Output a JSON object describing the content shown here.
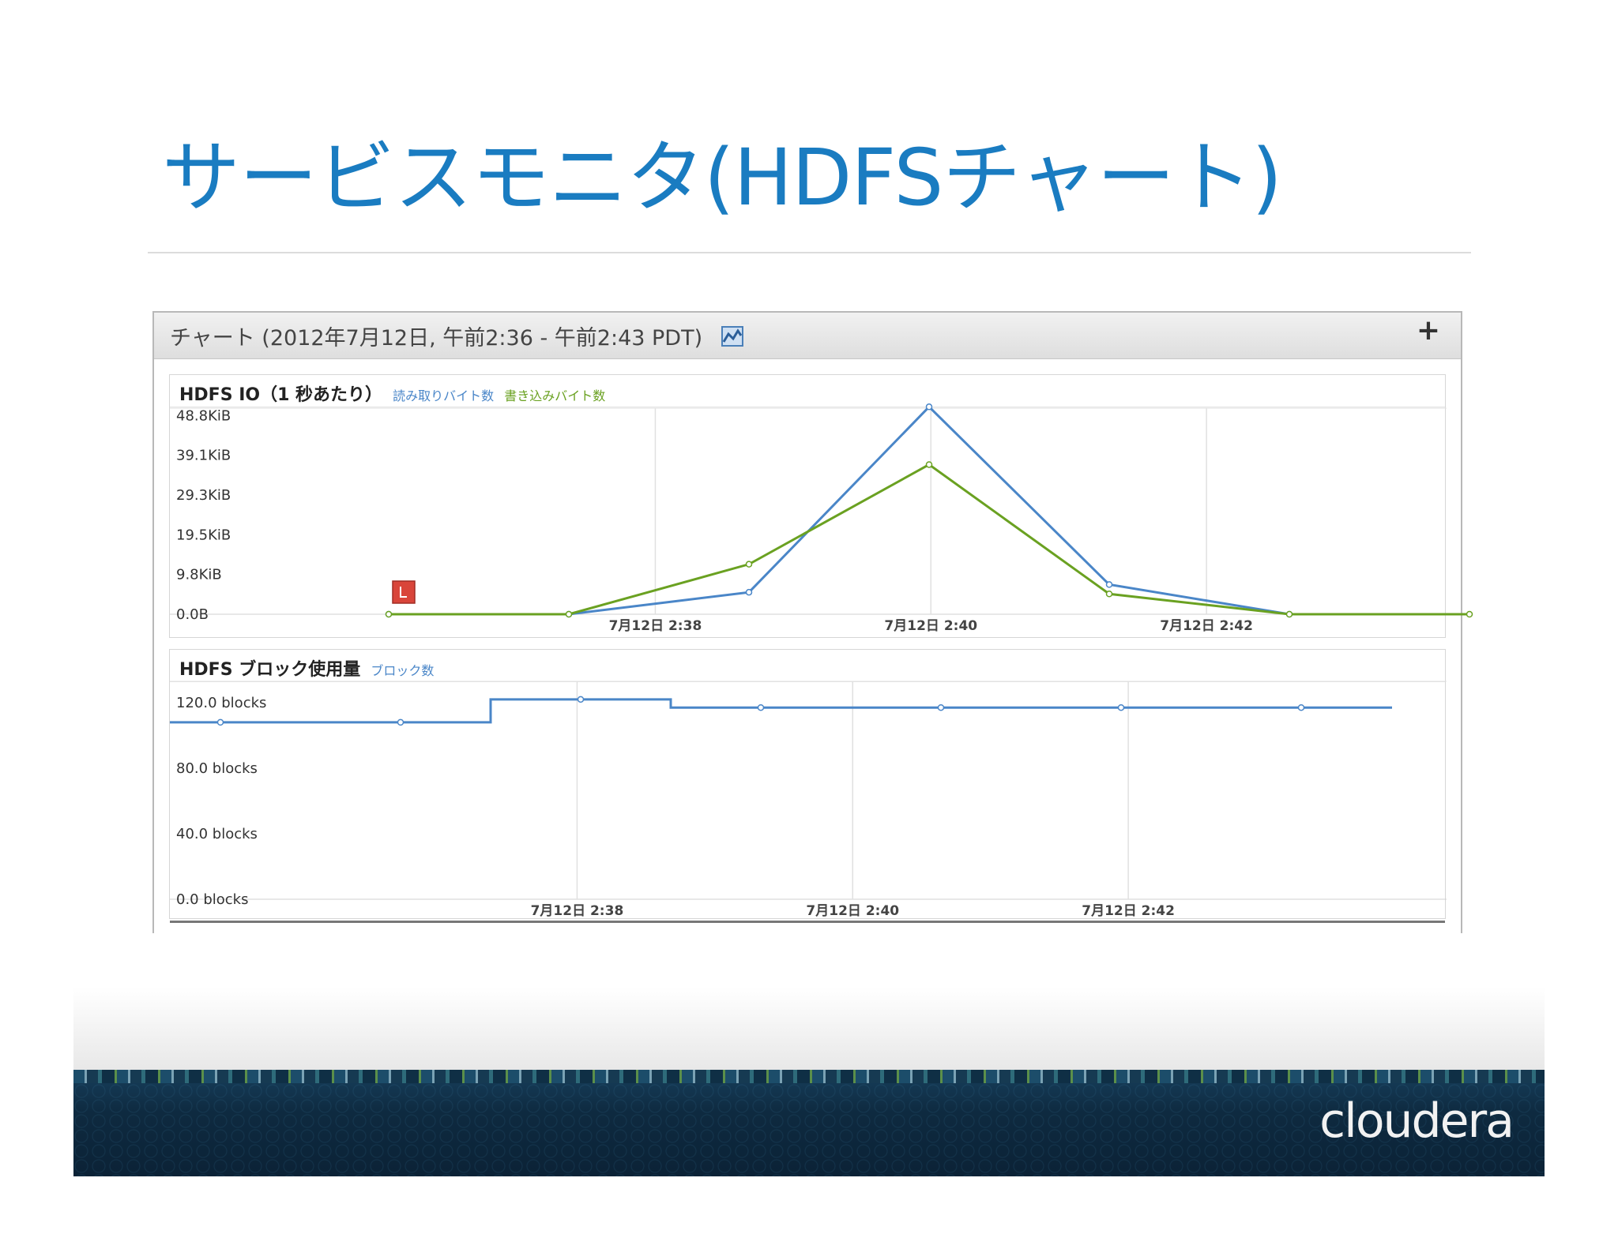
{
  "slide": {
    "title": "サービスモニタ(HDFSチャート)"
  },
  "screenshot": {
    "header_title": "チャート (2012年7月12日, 午前2:36 - 午前2:43 PDT)",
    "add_button": "+"
  },
  "charts": {
    "io": {
      "title": "HDFS IO（1 秒あたり）",
      "legend_read": "読み取りバイト数",
      "legend_write": "書き込みバイト数",
      "yticks": [
        "48.8KiB",
        "39.1KiB",
        "29.3KiB",
        "19.5KiB",
        "9.8KiB",
        "0.0B"
      ],
      "xticks": [
        "7月12日 2:38",
        "7月12日 2:40",
        "7月12日 2:42"
      ]
    },
    "blocks": {
      "title": "HDFS ブロック使用量",
      "legend": "ブロック数",
      "yticks": [
        "120.0 blocks",
        "80.0 blocks",
        "40.0 blocks",
        "0.0 blocks"
      ],
      "xticks": [
        "7月12日 2:38",
        "7月12日 2:40",
        "7月12日 2:42"
      ]
    }
  },
  "chart_data": [
    {
      "type": "line",
      "title": "HDFS IO（1 秒あたり）",
      "ylabel": "",
      "xlabel": "",
      "x": [
        "2:36:15",
        "2:37:15",
        "2:38:15",
        "2:39:15",
        "2:40:15",
        "2:41:15",
        "2:42:15"
      ],
      "xtick_labels": [
        "7月12日 2:38",
        "7月12日 2:40",
        "7月12日 2:42"
      ],
      "yticks": [
        0.0,
        9.8,
        19.5,
        29.3,
        39.1,
        48.8
      ],
      "yunit": "KiB",
      "ylim": [
        0,
        53
      ],
      "series": [
        {
          "name": "読み取りバイト数",
          "color": "#4a86c8",
          "values": [
            0,
            0,
            5.4,
            51.0,
            7.3,
            0,
            null
          ]
        },
        {
          "name": "書き込みバイト数",
          "color": "#6aa121",
          "values": [
            0,
            0,
            12.3,
            36.8,
            5.0,
            0,
            0
          ]
        }
      ],
      "annotation": "event-marker"
    },
    {
      "type": "line",
      "title": "HDFS ブロック使用量",
      "ylabel": "",
      "xlabel": "",
      "x": [
        "2:36:15",
        "2:37:15",
        "2:38:15",
        "2:39:15",
        "2:40:15",
        "2:41:15",
        "2:42:15"
      ],
      "xtick_labels": [
        "7月12日 2:38",
        "7月12日 2:40",
        "7月12日 2:42"
      ],
      "yticks": [
        0,
        40,
        80,
        120
      ],
      "ylim": [
        0,
        133
      ],
      "step": true,
      "series": [
        {
          "name": "ブロック数",
          "color": "#4a86c8",
          "values": [
            108,
            108,
            122,
            117,
            117,
            117,
            117
          ]
        }
      ]
    }
  ],
  "branding": {
    "logo": "cloudera"
  }
}
